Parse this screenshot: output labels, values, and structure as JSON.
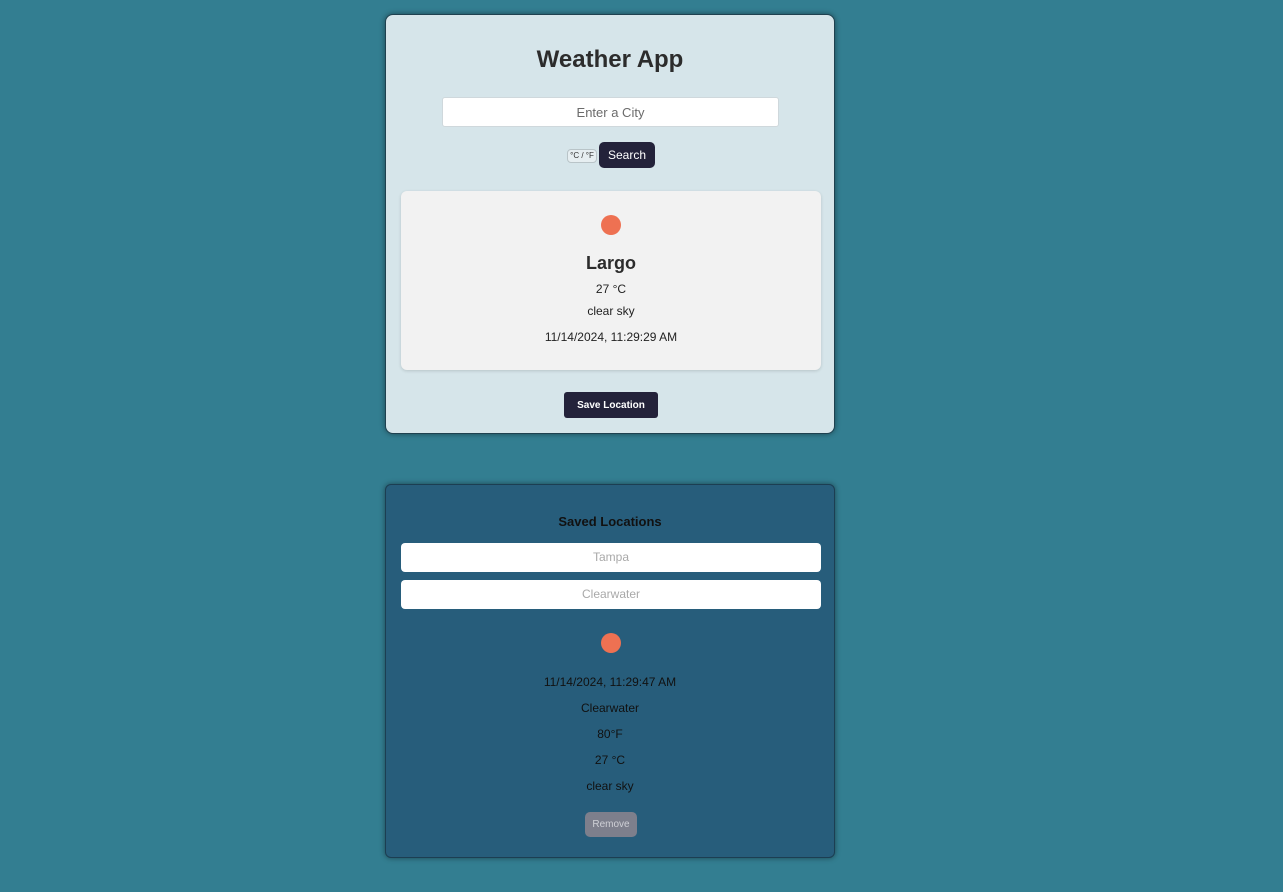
{
  "app": {
    "title": "Weather App"
  },
  "search": {
    "placeholder": "Enter a City",
    "value": "",
    "unit_toggle_label": "°C / °F",
    "button_label": "Search"
  },
  "current": {
    "icon": "weather-icon",
    "city": "Largo",
    "temp": "27 °C",
    "description": "clear sky",
    "datetime": "11/14/2024, 11:29:29 AM"
  },
  "save_button_label": "Save Location",
  "saved": {
    "title": "Saved Locations",
    "locations": [
      "Tampa",
      "Clearwater"
    ],
    "detail": {
      "icon": "weather-icon",
      "datetime": "11/14/2024, 11:29:47 AM",
      "city": "Clearwater",
      "temp_f": "80°F",
      "temp_c": "27 °C",
      "description": "clear sky"
    },
    "remove_label": "Remove"
  },
  "colors": {
    "background": "#337e91",
    "main_card": "#d6e5ea",
    "saved_card": "#275d7b",
    "button": "#23223a",
    "icon": "#ee7152"
  }
}
